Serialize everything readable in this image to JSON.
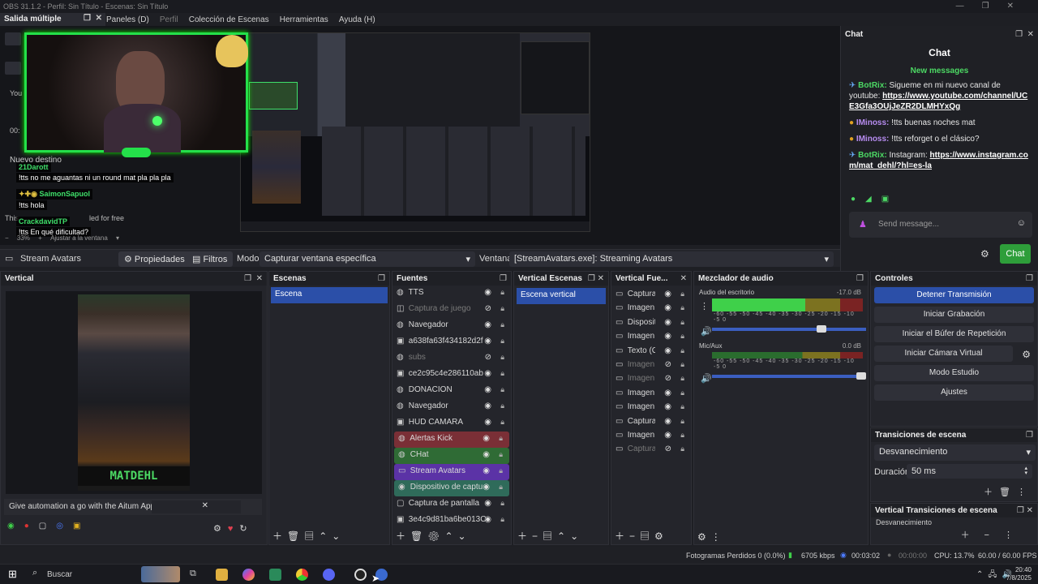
{
  "window": {
    "title": "OBS 31.1.2 - Perfil: Sin Título - Escenas: Sin Título"
  },
  "menu": {
    "output_label": "Salida múltiple",
    "items": [
      "Paneles (D)",
      "Perfil",
      "Colección de Escenas",
      "Herramientas",
      "Ayuda (H)"
    ]
  },
  "preview": {
    "chat_overlay": [
      {
        "name": "21Darott",
        "text": "!tts no me aguantas ni un round mat pla pla pla"
      },
      {
        "name": "SaimonSapuol",
        "text": "!tts hola"
      },
      {
        "name": "CrackdavidTP",
        "text": "!tts En qué dificultad?"
      }
    ],
    "behind_texts": [
      "Nuevo destino",
      "You",
      "00:",
      "This",
      "led for free"
    ],
    "zoom": "33%",
    "fit_label": "Ajustar a la ventana"
  },
  "source_toolbar": {
    "source_name": "Stream Avatars",
    "properties": "Propiedades",
    "filters": "Filtros",
    "mode_label": "Modo",
    "mode_value": "Capturar ventana específica",
    "window_label": "Ventana",
    "window_value": "[StreamAvatars.exe]: Streaming Avatars"
  },
  "vertical": {
    "title": "Vertical",
    "banner_text": "MATDEHL",
    "notice": "Give automation a go with the Aitum App"
  },
  "scenes": {
    "title": "Escenas",
    "items": [
      "Escena"
    ]
  },
  "sources": {
    "title": "Fuentes",
    "items": [
      {
        "label": "TTS",
        "icon": "globe-icon",
        "hidden": false,
        "color": ""
      },
      {
        "label": "Captura de juego",
        "icon": "gamepad-icon",
        "hidden": true,
        "color": ""
      },
      {
        "label": "Navegador",
        "icon": "globe-icon",
        "hidden": false,
        "color": ""
      },
      {
        "label": "a638fa63f434182d2f",
        "icon": "image-icon",
        "hidden": false,
        "color": ""
      },
      {
        "label": "subs",
        "icon": "globe-icon",
        "hidden": true,
        "color": ""
      },
      {
        "label": "ce2c95c4e286110ab",
        "icon": "image-icon",
        "hidden": false,
        "color": ""
      },
      {
        "label": "DONACION",
        "icon": "globe-icon",
        "hidden": false,
        "color": ""
      },
      {
        "label": "Navegador",
        "icon": "globe-icon",
        "hidden": false,
        "color": ""
      },
      {
        "label": "HUD CAMARA",
        "icon": "image-icon",
        "hidden": false,
        "color": ""
      },
      {
        "label": "Alertas Kick",
        "icon": "globe-icon",
        "hidden": false,
        "color": "#7a2f36"
      },
      {
        "label": "CHat",
        "icon": "globe-icon",
        "hidden": false,
        "color": "#2f6b35"
      },
      {
        "label": "Stream Avatars",
        "icon": "window-icon",
        "hidden": false,
        "color": "#5b33a6"
      },
      {
        "label": "Dispositivo de captu",
        "icon": "camera-icon",
        "hidden": false,
        "color": "#2f6b5a"
      },
      {
        "label": "Captura de pantalla",
        "icon": "monitor-icon",
        "hidden": false,
        "color": ""
      },
      {
        "label": "3e4c9d81ba6be013C",
        "icon": "image-icon",
        "hidden": false,
        "color": ""
      }
    ]
  },
  "vertical_scenes": {
    "title": "Vertical Escenas",
    "items": [
      "Escena vertical"
    ]
  },
  "vertical_sources": {
    "title": "Vertical Fue...",
    "items": [
      {
        "label": "Captura",
        "hidden": false
      },
      {
        "label": "Imagen 2",
        "hidden": false
      },
      {
        "label": "Dispositi",
        "hidden": false
      },
      {
        "label": "Imagen 3",
        "hidden": false
      },
      {
        "label": "Texto (G)",
        "hidden": false
      },
      {
        "label": "Imagen 5",
        "hidden": true
      },
      {
        "label": "Imagen 4",
        "hidden": true
      },
      {
        "label": "Imagen 2",
        "hidden": false
      },
      {
        "label": "Imagen",
        "hidden": false
      },
      {
        "label": "Captura",
        "hidden": false
      },
      {
        "label": "Imagen I",
        "hidden": false
      },
      {
        "label": "Captura",
        "hidden": true
      }
    ]
  },
  "mixer": {
    "title": "Mezclador de audio",
    "channels": [
      {
        "name": "Audio del escritorio",
        "db": "-17.0 dB",
        "level": 0.62,
        "volume": 0.74
      },
      {
        "name": "Mic/Aux",
        "db": "0.0 dB",
        "level": 0.0,
        "volume": 1.0
      }
    ],
    "scale": "-60 -55 -50 -45 -40 -35 -30 -25 -20 -15 -10 -5 0"
  },
  "controls": {
    "title": "Controles",
    "buttons": [
      "Detener Transmisión",
      "Iniciar Grabación",
      "Iniciar el Búfer de Repetición",
      "Iniciar Cámara Virtual",
      "Modo Estudio",
      "Ajustes"
    ]
  },
  "transitions": {
    "title": "Transiciones de escena",
    "value": "Desvanecimiento",
    "duration_label": "Duración",
    "duration_value": "50 ms"
  },
  "vertical_transitions": {
    "title": "Vertical Transiciones de escena",
    "value": "Desvanecimiento"
  },
  "chat": {
    "dock_title": "Chat",
    "header": "Chat",
    "new_messages": "New messages",
    "messages": [
      {
        "user": "BotRix:",
        "color": "#4cd964",
        "text": "Sigueme en mi nuevo canal de youtube:",
        "link": "https://www.youtube.com/channel/UCE3Gfa3OUjJeZR2DLMHYxQg"
      },
      {
        "user": "IMinoss:",
        "color": "#b78cf0",
        "text": "!tts buenas noches mat",
        "link": ""
      },
      {
        "user": "IMinoss:",
        "color": "#b78cf0",
        "text": "!tts reforget o el clásico?",
        "link": ""
      },
      {
        "user": "BotRix:",
        "color": "#4cd964",
        "text": "Instagram:",
        "link": "https://www.instagram.com/mat_dehl/?hl=es-la"
      }
    ],
    "input_placeholder": "Send message...",
    "send_label": "Chat",
    "accent": "#2e9e3a"
  },
  "status": {
    "dropped": "Fotogramas Perdidos 0 (0.0%)",
    "bitrate": "6705 kbps",
    "stream_time": "00:03:02",
    "rec_time": "00:00:00",
    "cpu": "CPU: 13.7%",
    "fps": "60.00 / 60.00 FPS"
  },
  "taskbar": {
    "search": "Buscar",
    "time": "20:40",
    "date": "7/8/2025"
  }
}
